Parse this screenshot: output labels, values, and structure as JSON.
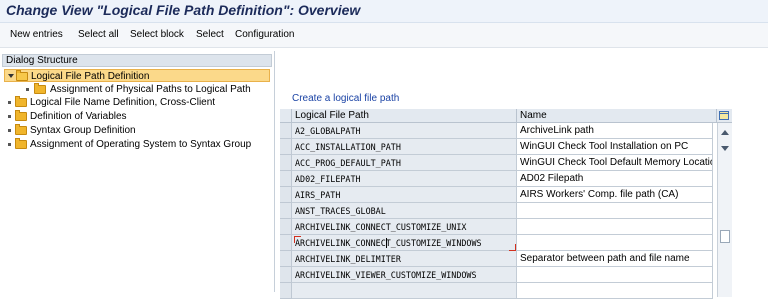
{
  "window": {
    "title": "Change View \"Logical File Path Definition\": Overview"
  },
  "toolbar": {
    "buttons": [
      "New entries",
      "Select all",
      "Select block",
      "Select",
      "Configuration"
    ]
  },
  "dialog_structure": {
    "header": "Dialog Structure",
    "items": [
      {
        "label": "Logical File Path Definition",
        "level": 0,
        "selected": true,
        "expanded": true
      },
      {
        "label": "Assignment of Physical Paths to Logical Path",
        "level": 1,
        "selected": false
      },
      {
        "label": "Logical File Name Definition, Cross-Client",
        "level": 0,
        "selected": false
      },
      {
        "label": "Definition of Variables",
        "level": 0,
        "selected": false
      },
      {
        "label": "Syntax Group Definition",
        "level": 0,
        "selected": false
      },
      {
        "label": "Assignment of Operating System to Syntax Group",
        "level": 0,
        "selected": false
      }
    ]
  },
  "main": {
    "create_link": "Create a logical file path",
    "columns": [
      "Logical File Path",
      "Name"
    ],
    "rows": [
      {
        "path": "A2_GLOBALPATH",
        "name": "ArchiveLink path"
      },
      {
        "path": "ACC_INSTALLATION_PATH",
        "name": "WinGUI Check Tool Installation on PC"
      },
      {
        "path": "ACC_PROG_DEFAULT_PATH",
        "name": "WinGUI Check Tool Default Memory Location"
      },
      {
        "path": "AD02_FILEPATH",
        "name": "AD02 Filepath"
      },
      {
        "path": "AIRS_PATH",
        "name": "AIRS Workers' Comp. file path (CA)"
      },
      {
        "path": "ANST_TRACES_GLOBAL",
        "name": ""
      },
      {
        "path": "ARCHIVELINK_CONNECT_CUSTOMIZE_UNIX",
        "name": ""
      },
      {
        "path": "ARCHIVELINK_CONNECT_CUSTOMIZE_WINDOWS",
        "name": "",
        "focused": true
      },
      {
        "path": "ARCHIVELINK_DELIMITER",
        "name": "Separator between path and file name"
      },
      {
        "path": "ARCHIVELINK_VIEWER_CUSTOMIZE_WINDOWS",
        "name": ""
      },
      {
        "path": "",
        "name": ""
      }
    ]
  },
  "icons": {
    "folder": "folder-icon",
    "column_config": "table-settings-icon",
    "scroll_up": "scroll-up-icon",
    "scroll_down": "scroll-down-icon"
  },
  "colors": {
    "title_text": "#1c2b5a",
    "selected_node": "#fbd98a",
    "link": "#1b43a5",
    "key_cell": "#e6ebf1",
    "focus_marker": "#d2301e"
  }
}
